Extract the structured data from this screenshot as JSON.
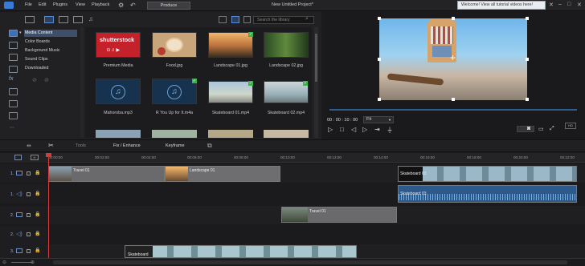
{
  "menubar": {
    "items": [
      "File",
      "Edit",
      "Plugins",
      "View",
      "Playback"
    ],
    "produce_label": "Produce",
    "project_title": "New Untitled Project*",
    "toast": "Welcome! View all tutorial videos here!"
  },
  "library": {
    "search_placeholder": "Search the library",
    "categories": [
      "Media Content",
      "Color Boards",
      "Background Music",
      "Sound Clips",
      "Downloaded"
    ],
    "thumbnails": [
      {
        "label": "Premium Media",
        "kind": "shutterstock"
      },
      {
        "label": "Food.jpg",
        "kind": "food"
      },
      {
        "label": "Landscape 01.jpg",
        "kind": "landscape1"
      },
      {
        "label": "Landscape 02.jpg",
        "kind": "landscape2"
      },
      {
        "label": "Mahoroba.mp3",
        "kind": "music"
      },
      {
        "label": "R You Up for It.m4a",
        "kind": "music"
      },
      {
        "label": "Skateboard 01.mp4",
        "kind": "skate1"
      },
      {
        "label": "Skateboard 02.mp4",
        "kind": "skate2"
      }
    ],
    "shutterstock_text": "shutterstock"
  },
  "preview": {
    "timecode": "00 : 00 : 10 : 00",
    "zoom": "Fit"
  },
  "edit_toolbar": {
    "tools": "Tools",
    "fix": "Fix / Enhance",
    "keyframe": "Keyframe"
  },
  "ruler": {
    "ticks": [
      "00:00:00",
      "00:02:00",
      "00:04:00",
      "00:06:00",
      "00:08:00",
      "00:10:00",
      "00:12:00",
      "00:14:00",
      "00:16:00",
      "00:18:00",
      "00:20:00",
      "00:22:00"
    ]
  },
  "tracks": [
    {
      "num": "1."
    },
    {
      "num": "1."
    },
    {
      "num": "2."
    },
    {
      "num": "2."
    },
    {
      "num": "3."
    }
  ],
  "clips": {
    "travel01": "Travel 01",
    "landscape01": "Landscape 01",
    "travel01b": "Travel 01",
    "skateboard03": "Skateboard 03",
    "skateboard03_audio": "Skateboard 03",
    "skateboard_bottom": "Skateboard"
  }
}
